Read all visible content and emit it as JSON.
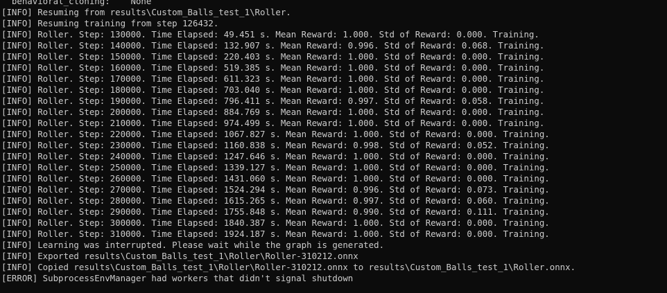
{
  "terminal": {
    "lines": [
      "  behavioral_cloning:    None",
      "[INFO] Resuming from results\\Custom_Balls_test_1\\Roller.",
      "[INFO] Resuming training from step 126432.",
      "[INFO] Roller. Step: 130000. Time Elapsed: 49.451 s. Mean Reward: 1.000. Std of Reward: 0.000. Training.",
      "[INFO] Roller. Step: 140000. Time Elapsed: 132.907 s. Mean Reward: 0.996. Std of Reward: 0.068. Training.",
      "[INFO] Roller. Step: 150000. Time Elapsed: 220.403 s. Mean Reward: 1.000. Std of Reward: 0.000. Training.",
      "[INFO] Roller. Step: 160000. Time Elapsed: 519.385 s. Mean Reward: 1.000. Std of Reward: 0.000. Training.",
      "[INFO] Roller. Step: 170000. Time Elapsed: 611.323 s. Mean Reward: 1.000. Std of Reward: 0.000. Training.",
      "[INFO] Roller. Step: 180000. Time Elapsed: 703.040 s. Mean Reward: 1.000. Std of Reward: 0.000. Training.",
      "[INFO] Roller. Step: 190000. Time Elapsed: 796.411 s. Mean Reward: 0.997. Std of Reward: 0.058. Training.",
      "[INFO] Roller. Step: 200000. Time Elapsed: 884.769 s. Mean Reward: 1.000. Std of Reward: 0.000. Training.",
      "[INFO] Roller. Step: 210000. Time Elapsed: 974.499 s. Mean Reward: 1.000. Std of Reward: 0.000. Training.",
      "[INFO] Roller. Step: 220000. Time Elapsed: 1067.827 s. Mean Reward: 1.000. Std of Reward: 0.000. Training.",
      "[INFO] Roller. Step: 230000. Time Elapsed: 1160.838 s. Mean Reward: 0.998. Std of Reward: 0.052. Training.",
      "[INFO] Roller. Step: 240000. Time Elapsed: 1247.646 s. Mean Reward: 1.000. Std of Reward: 0.000. Training.",
      "[INFO] Roller. Step: 250000. Time Elapsed: 1339.127 s. Mean Reward: 1.000. Std of Reward: 0.000. Training.",
      "[INFO] Roller. Step: 260000. Time Elapsed: 1431.060 s. Mean Reward: 1.000. Std of Reward: 0.000. Training.",
      "[INFO] Roller. Step: 270000. Time Elapsed: 1524.294 s. Mean Reward: 0.996. Std of Reward: 0.073. Training.",
      "[INFO] Roller. Step: 280000. Time Elapsed: 1615.265 s. Mean Reward: 0.997. Std of Reward: 0.060. Training.",
      "[INFO] Roller. Step: 290000. Time Elapsed: 1755.848 s. Mean Reward: 0.990. Std of Reward: 0.111. Training.",
      "[INFO] Roller. Step: 300000. Time Elapsed: 1840.387 s. Mean Reward: 1.000. Std of Reward: 0.000. Training.",
      "[INFO] Roller. Step: 310000. Time Elapsed: 1924.187 s. Mean Reward: 1.000. Std of Reward: 0.000. Training.",
      "[INFO] Learning was interrupted. Please wait while the graph is generated.",
      "[INFO] Exported results\\Custom_Balls_test_1\\Roller\\Roller-310212.onnx",
      "[INFO] Copied results\\Custom_Balls_test_1\\Roller\\Roller-310212.onnx to results\\Custom_Balls_test_1\\Roller.onnx.",
      "[ERROR] SubprocessEnvManager had workers that didn't signal shutdown"
    ]
  },
  "colors": {
    "background": "#0c0c0c",
    "text": "#cccccc"
  }
}
